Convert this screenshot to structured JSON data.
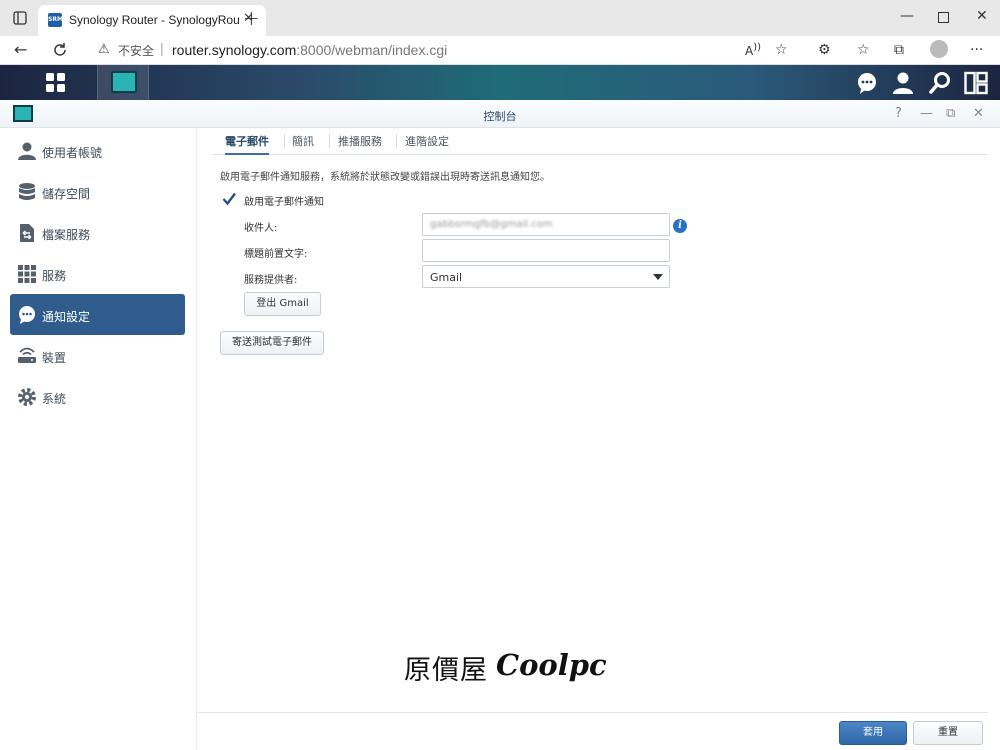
{
  "browser": {
    "tab_title": "Synology Router - SynologyRouter",
    "tab_favicon": "SRM",
    "url_warning": "不安全",
    "url_host": "router.synology.com",
    "url_path": ":8000/webman/index.cgi"
  },
  "window": {
    "title": "控制台"
  },
  "sidebar": {
    "items": [
      {
        "label": "使用者帳號",
        "icon": "user-icon"
      },
      {
        "label": "儲存空間",
        "icon": "storage-icon"
      },
      {
        "label": "檔案服務",
        "icon": "file-services-icon"
      },
      {
        "label": "服務",
        "icon": "services-icon"
      },
      {
        "label": "通知設定",
        "icon": "notification-icon",
        "active": true
      },
      {
        "label": "裝置",
        "icon": "device-icon"
      },
      {
        "label": "系統",
        "icon": "system-icon"
      }
    ]
  },
  "tabs": [
    "電子郵件",
    "簡訊",
    "推播服務",
    "進階設定"
  ],
  "email": {
    "description": "啟用電子郵件通知服務，系統將於狀態改變或錯誤出現時寄送訊息通知您。",
    "enable_label": "啟用電子郵件通知",
    "enabled": true,
    "recipient_label": "收件人:",
    "recipient_value": "gabbsrmgfb@gmail.com",
    "subject_prefix_label": "標題前置文字:",
    "subject_prefix_value": "",
    "provider_label": "服務提供者:",
    "provider_value": "Gmail",
    "logout_button": "登出 Gmail",
    "send_test_button": "寄送測試電子郵件"
  },
  "watermark": {
    "cn": "原價屋",
    "en": "Coolpc"
  },
  "footer": {
    "apply": "套用",
    "reset": "重置"
  },
  "colors": {
    "active": "#2f5c8c",
    "primary": "#2f67a8",
    "info": "#2672c3"
  }
}
